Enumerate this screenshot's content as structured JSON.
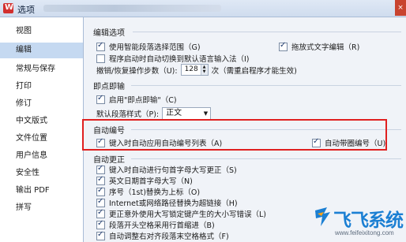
{
  "window": {
    "title": "选项",
    "close_label": "×"
  },
  "sidebar": {
    "items": [
      {
        "label": "视图"
      },
      {
        "label": "编辑"
      },
      {
        "label": "常规与保存"
      },
      {
        "label": "打印"
      },
      {
        "label": "修订"
      },
      {
        "label": "中文版式"
      },
      {
        "label": "文件位置"
      },
      {
        "label": "用户信息"
      },
      {
        "label": "安全性"
      },
      {
        "label": "输出 PDF"
      },
      {
        "label": "拼写"
      }
    ],
    "active_index": 1
  },
  "edit_options": {
    "title": "编辑选项",
    "smart_select": {
      "label": "使用智能段落选择范围（G)",
      "checked": true
    },
    "drag_drop": {
      "label": "拖放式文字编辑（R)",
      "checked": true
    },
    "auto_ime": {
      "label": "程序启动时自动切换到默认语言输入法（I)",
      "checked": false
    },
    "undo_steps_label": "撤销/恢复操作步数（U):",
    "undo_steps_value": "128",
    "undo_steps_note": "次（需重启程序才能生效)"
  },
  "instant_type": {
    "title": "即点即输",
    "enable": {
      "label": "启用\"即点即输\"（C)",
      "checked": true
    },
    "default_style_label": "默认段落样式（P):",
    "default_style_value": "正文"
  },
  "auto_number": {
    "title": "自动编号",
    "apply_on_type": {
      "label": "键入时自动应用自动编号列表（A)",
      "checked": true
    },
    "circle_number": {
      "label": "自动带圈编号（U)",
      "checked": true
    }
  },
  "auto_correct": {
    "title": "自动更正",
    "items": [
      {
        "label": "键入时自动进行句首字母大写更正（S)",
        "checked": true
      },
      {
        "label": "英文日期首字母大写（N)",
        "checked": true
      },
      {
        "label": "序号（1st)替换为上标（O)",
        "checked": true
      },
      {
        "label": "Internet或网络路径替换为超链接（H)",
        "checked": true
      },
      {
        "label": "更正意外使用大写锁定键产生的大小写错误（L)",
        "checked": true
      },
      {
        "label": "段落开头空格采用行首缩进（B)",
        "checked": true
      },
      {
        "label": "自动调整右对齐段落末空格格式（F)",
        "checked": true
      }
    ]
  },
  "watermark": {
    "brand": "飞飞系统",
    "url": "www.feifeixitong.com",
    "color": "#1b7fd3"
  }
}
